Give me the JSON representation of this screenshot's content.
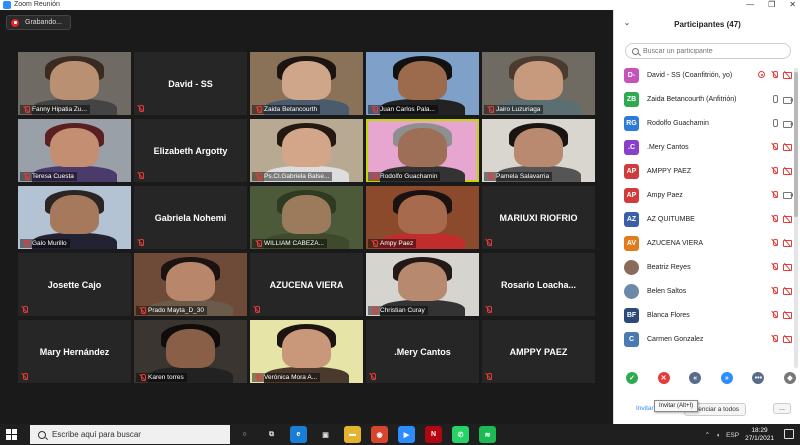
{
  "window": {
    "title": "Zoom Reunión",
    "controls": [
      "—",
      "❐",
      "✕"
    ]
  },
  "recording": {
    "label": "Grabando..."
  },
  "tiles": [
    {
      "name": "Fanny Hipatia Zu...",
      "type": "video",
      "bg": "#6f6a63",
      "face": "#b99072",
      "hair": "#3a2b22",
      "shirt": "#444"
    },
    {
      "name": "David - SS",
      "type": "name"
    },
    {
      "name": "Zaida Betancourth",
      "type": "video",
      "bg": "#8a7258",
      "face": "#d0a68a",
      "hair": "#1b1410",
      "shirt": "#4b5b6e"
    },
    {
      "name": "Juan Carlos Pala...",
      "type": "video",
      "bg": "#7fa0c8",
      "face": "#9c6a4d",
      "hair": "#111",
      "shirt": "#222"
    },
    {
      "name": "Jairo Luzuriaga",
      "type": "video",
      "bg": "#6f6a62",
      "face": "#c79a7d",
      "hair": "#4a3a30",
      "shirt": "#5b6e72"
    },
    {
      "name": "Teresa Cuesta",
      "type": "video",
      "bg": "#9aa0a8",
      "face": "#c48e73",
      "hair": "#5a1f20",
      "shirt": "#4b3b6a"
    },
    {
      "name": "Elizabeth Argotty",
      "type": "name"
    },
    {
      "name": "Ps.Cl.Gabriela Balse...",
      "type": "video",
      "bg": "#b8a993",
      "face": "#d3a68a",
      "hair": "#241812",
      "shirt": "#ddd"
    },
    {
      "name": "Rodolfo Guachamin",
      "type": "video",
      "bg": "#e6a6cf",
      "face": "#9d6f56",
      "hair": "#8f8f8f",
      "shirt": "#333",
      "active": true
    },
    {
      "name": "Pamela Salavarria",
      "type": "video",
      "bg": "#d9d6d0",
      "face": "#b98a6f",
      "hair": "#1a1512",
      "shirt": "#555"
    },
    {
      "name": "Galo Murillo",
      "type": "video",
      "bg": "#b3c3d3",
      "face": "#a7795c",
      "hair": "#2b2623",
      "shirt": "#223"
    },
    {
      "name": "Gabriela Nohemi",
      "type": "name"
    },
    {
      "name": "WILLIAM CABEZA...",
      "type": "video",
      "bg": "#4d5a3a",
      "face": "#9b7b5c",
      "hair": "#2f3a22",
      "shirt": "#3f4a2c"
    },
    {
      "name": "Ampy Paez",
      "type": "video",
      "bg": "#8c4a2c",
      "face": "#a86a4c",
      "hair": "#1a1210",
      "shirt": "#c12d2d"
    },
    {
      "name": "MARIUXI RIOFRIO",
      "type": "name"
    },
    {
      "name": "Josette Cajo",
      "type": "name"
    },
    {
      "name": "Prado Mayta_D_30",
      "type": "video",
      "bg": "#6e4b38",
      "face": "#b8876b",
      "hair": "#1a1311",
      "shirt": "#6b5b4b"
    },
    {
      "name": "AZUCENA VIERA",
      "type": "name"
    },
    {
      "name": "Christian Curay",
      "type": "video",
      "bg": "#d6d4cf",
      "face": "#b78a70",
      "hair": "#231a16",
      "shirt": "#333"
    },
    {
      "name": "Rosario  Loacha...",
      "type": "name"
    },
    {
      "name": "Mary Hernández",
      "type": "name"
    },
    {
      "name": "Karen torres",
      "type": "video",
      "bg": "#3a3530",
      "face": "#8a5f47",
      "hair": "#0f0c0b",
      "shirt": "#222"
    },
    {
      "name": "Verónica Mora A...",
      "type": "video",
      "bg": "#e7e4a8",
      "face": "#c9977a",
      "hair": "#1b1411",
      "shirt": "#4a3a2e"
    },
    {
      "name": ".Mery Cantos",
      "type": "name"
    },
    {
      "name": "AMPPY PAEZ",
      "type": "name"
    }
  ],
  "panel": {
    "title": "Participantes (47)",
    "collapse_icon": "chevron-down-icon",
    "search_placeholder": "Buscar un participante",
    "participants": [
      {
        "initials": "D-",
        "color": "#c455b8",
        "name": "David - SS (Coanfitrión, yo)",
        "share": true,
        "mic": "muted",
        "cam": "off"
      },
      {
        "initials": "ZB",
        "color": "#2eaa4f",
        "name": "Zaida Betancourth (Anfitrión)",
        "mic": "on",
        "cam": "on"
      },
      {
        "initials": "RG",
        "color": "#2d7bd8",
        "name": "Rodolfo Guachamin",
        "mic": "on",
        "cam": "on"
      },
      {
        "initials": ".C",
        "color": "#8a3fc9",
        "name": ".Mery Cantos",
        "mic": "muted",
        "cam": "off"
      },
      {
        "initials": "AP",
        "color": "#d23b3b",
        "name": "AMPPY PAEZ",
        "mic": "muted",
        "cam": "off"
      },
      {
        "initials": "AP",
        "color": "#d23b3b",
        "name": "Ampy Paez",
        "mic": "muted",
        "cam": "on"
      },
      {
        "initials": "AZ",
        "color": "#3a5fa8",
        "name": "AZ QUITUMBE",
        "mic": "muted",
        "cam": "off"
      },
      {
        "initials": "AV",
        "color": "#e27b1e",
        "name": "AZUCENA VIERA",
        "mic": "muted",
        "cam": "off"
      },
      {
        "initials": "",
        "color": "#8a6a58",
        "name": "Beatriz Reyes",
        "photo": true,
        "mic": "muted",
        "cam": "off"
      },
      {
        "initials": "",
        "color": "#6c8aa8",
        "name": "Belen Saltos",
        "photo": true,
        "mic": "muted",
        "cam": "off"
      },
      {
        "initials": "BF",
        "color": "#2b4a7a",
        "name": "Blanca Flores",
        "mic": "muted",
        "cam": "off"
      },
      {
        "initials": "C",
        "color": "#4a7ab0",
        "name": "Carmen Gonzalez",
        "mic": "muted",
        "cam": "off"
      }
    ],
    "reactions": [
      {
        "icon": "check-icon",
        "color": "#2eaa4f",
        "glyph": "✓"
      },
      {
        "icon": "x-icon",
        "color": "#e43b3b",
        "glyph": "✕"
      },
      {
        "icon": "slower-icon",
        "color": "#5a6b8a",
        "glyph": "«"
      },
      {
        "icon": "faster-icon",
        "color": "#2d8cff",
        "glyph": "»"
      },
      {
        "icon": "more-reactions-icon",
        "color": "#5a6b8a",
        "glyph": "•••"
      },
      {
        "icon": "clear-icon",
        "color": "#777",
        "glyph": "◆"
      }
    ],
    "invite_label": "Invitar",
    "tooltip": "Invitar (Alt+I)",
    "mute_all_label": "Silenciar a todos",
    "more_label": "..."
  },
  "taskbar": {
    "search_placeholder": "Escribe aquí para buscar",
    "apps": [
      {
        "icon": "cortana-icon",
        "color": "#1f1f1f",
        "glyph": "○"
      },
      {
        "icon": "task-view-icon",
        "color": "#1f1f1f",
        "glyph": "⧉"
      },
      {
        "icon": "edge-icon",
        "color": "#1a7fd4",
        "glyph": "e"
      },
      {
        "icon": "store-icon",
        "color": "#1f1f1f",
        "glyph": "▣"
      },
      {
        "icon": "explorer-icon",
        "color": "#e6b32e",
        "glyph": "▬"
      },
      {
        "icon": "chrome-icon",
        "color": "#d8452e",
        "glyph": "◉"
      },
      {
        "icon": "zoom-icon",
        "color": "#2d8cff",
        "glyph": "▶",
        "active": true
      },
      {
        "icon": "netflix-icon",
        "color": "#b20710",
        "glyph": "N"
      },
      {
        "icon": "whatsapp-icon",
        "color": "#25d366",
        "glyph": "✆"
      },
      {
        "icon": "spotify-icon",
        "color": "#1db954",
        "glyph": "≋"
      }
    ],
    "tray_language": "ESP",
    "time": "18:29",
    "date": "27/1/2021"
  }
}
